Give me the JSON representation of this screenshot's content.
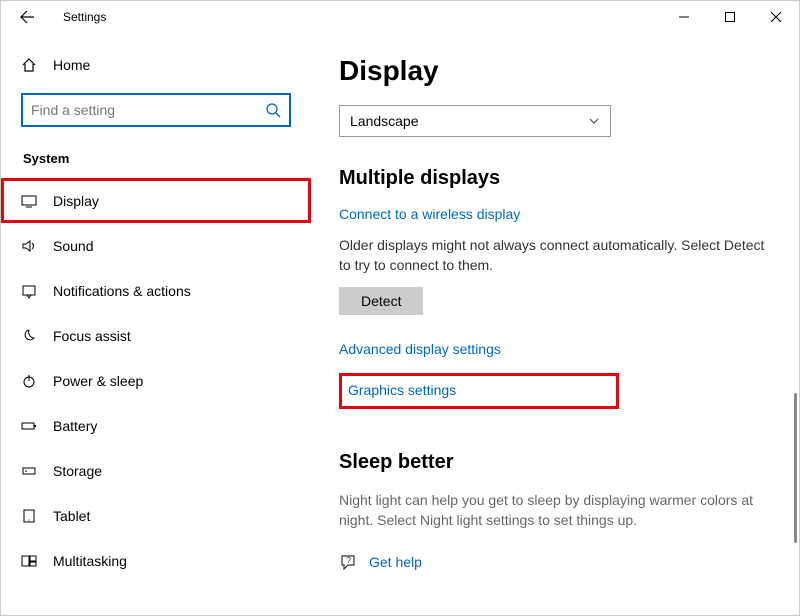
{
  "titlebar": {
    "title": "Settings"
  },
  "sidebar": {
    "home": "Home",
    "search_placeholder": "Find a setting",
    "section": "System",
    "items": [
      {
        "label": "Display"
      },
      {
        "label": "Sound"
      },
      {
        "label": "Notifications & actions"
      },
      {
        "label": "Focus assist"
      },
      {
        "label": "Power & sleep"
      },
      {
        "label": "Battery"
      },
      {
        "label": "Storage"
      },
      {
        "label": "Tablet"
      },
      {
        "label": "Multitasking"
      }
    ]
  },
  "page": {
    "title": "Display",
    "orientation": "Landscape",
    "multiple_displays_heading": "Multiple displays",
    "connect_wireless": "Connect to a wireless display",
    "older_displays_text": "Older displays might not always connect automatically. Select Detect to try to connect to them.",
    "detect_button": "Detect",
    "advanced_link": "Advanced display settings",
    "graphics_link": "Graphics settings",
    "sleep_heading": "Sleep better",
    "sleep_text": "Night light can help you get to sleep by displaying warmer colors at night. Select Night light settings to set things up.",
    "get_help": "Get help"
  }
}
